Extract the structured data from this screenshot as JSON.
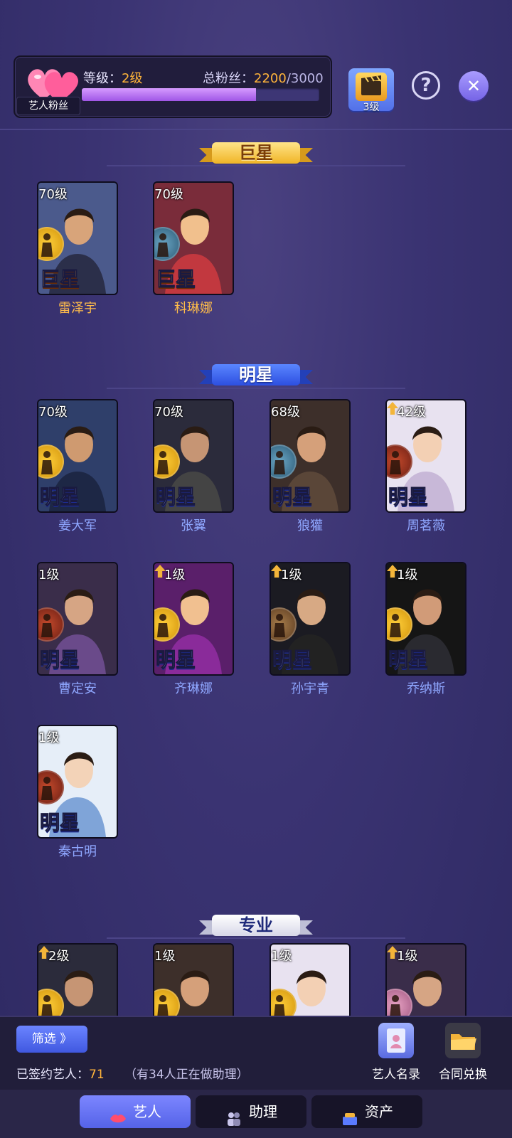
{
  "header": {
    "fan_badge": "艺人粉丝",
    "level_label": "等级：",
    "level_value": "2级",
    "fans_label": "总粉丝：",
    "fans_current": "2200",
    "fans_total": "/3000",
    "fans_progress": 0.7333,
    "film_level": "3级",
    "help_symbol": "?",
    "close_symbol": "✕"
  },
  "sections": {
    "superstar": "巨星",
    "star": "明星",
    "pro": "专业"
  },
  "superstars": [
    {
      "level": "70级",
      "rank": "巨星",
      "name": "雷泽宇",
      "role": "soldier",
      "upgrade": false
    },
    {
      "level": "70级",
      "rank": "巨星",
      "name": "科琳娜",
      "role": "ufo",
      "upgrade": false
    }
  ],
  "stars": [
    {
      "level": "70级",
      "rank": "明星",
      "name": "姜大军",
      "role": "soldier",
      "upgrade": false
    },
    {
      "level": "70级",
      "rank": "明星",
      "name": "张翼",
      "role": "soldier",
      "upgrade": false
    },
    {
      "level": "68级",
      "rank": "明星",
      "name": "狼獾",
      "role": "ufo",
      "upgrade": false
    },
    {
      "level": "42级",
      "rank": "明星",
      "name": "周茗薇",
      "role": "red",
      "upgrade": true
    },
    {
      "level": "1级",
      "rank": "明星",
      "name": "曹定安",
      "role": "red",
      "upgrade": false
    },
    {
      "level": "1级",
      "rank": "明星",
      "name": "齐琳娜",
      "role": "soldier",
      "upgrade": true
    },
    {
      "level": "1级",
      "rank": "明星",
      "name": "孙宇青",
      "role": "brown",
      "upgrade": true
    },
    {
      "level": "1级",
      "rank": "明星",
      "name": "乔纳斯",
      "role": "soldier",
      "upgrade": true
    },
    {
      "level": "1级",
      "rank": "明星",
      "name": "秦古明",
      "role": "red",
      "upgrade": false
    }
  ],
  "pros": [
    {
      "level": "2级",
      "upgrade": true,
      "role": "soldier"
    },
    {
      "level": "1级",
      "upgrade": false,
      "role": "soldier"
    },
    {
      "level": "1级",
      "upgrade": false,
      "role": "soldier"
    },
    {
      "level": "1级",
      "upgrade": true,
      "role": "pink"
    }
  ],
  "footer": {
    "filter_label": "筛选 》",
    "signed_label": "已签约艺人：",
    "signed_count": "71",
    "assist_note": "（有34人正在做助理）",
    "directory_label": "艺人名录",
    "exchange_label": "合同兑换"
  },
  "tabs": [
    {
      "label": "艺人",
      "active": true
    },
    {
      "label": "助理",
      "active": false
    },
    {
      "label": "资产",
      "active": false
    }
  ],
  "colors": {
    "accent_gold": "#ffb43a",
    "star_blue": "#8fa7ff",
    "background": "#3a3372"
  }
}
